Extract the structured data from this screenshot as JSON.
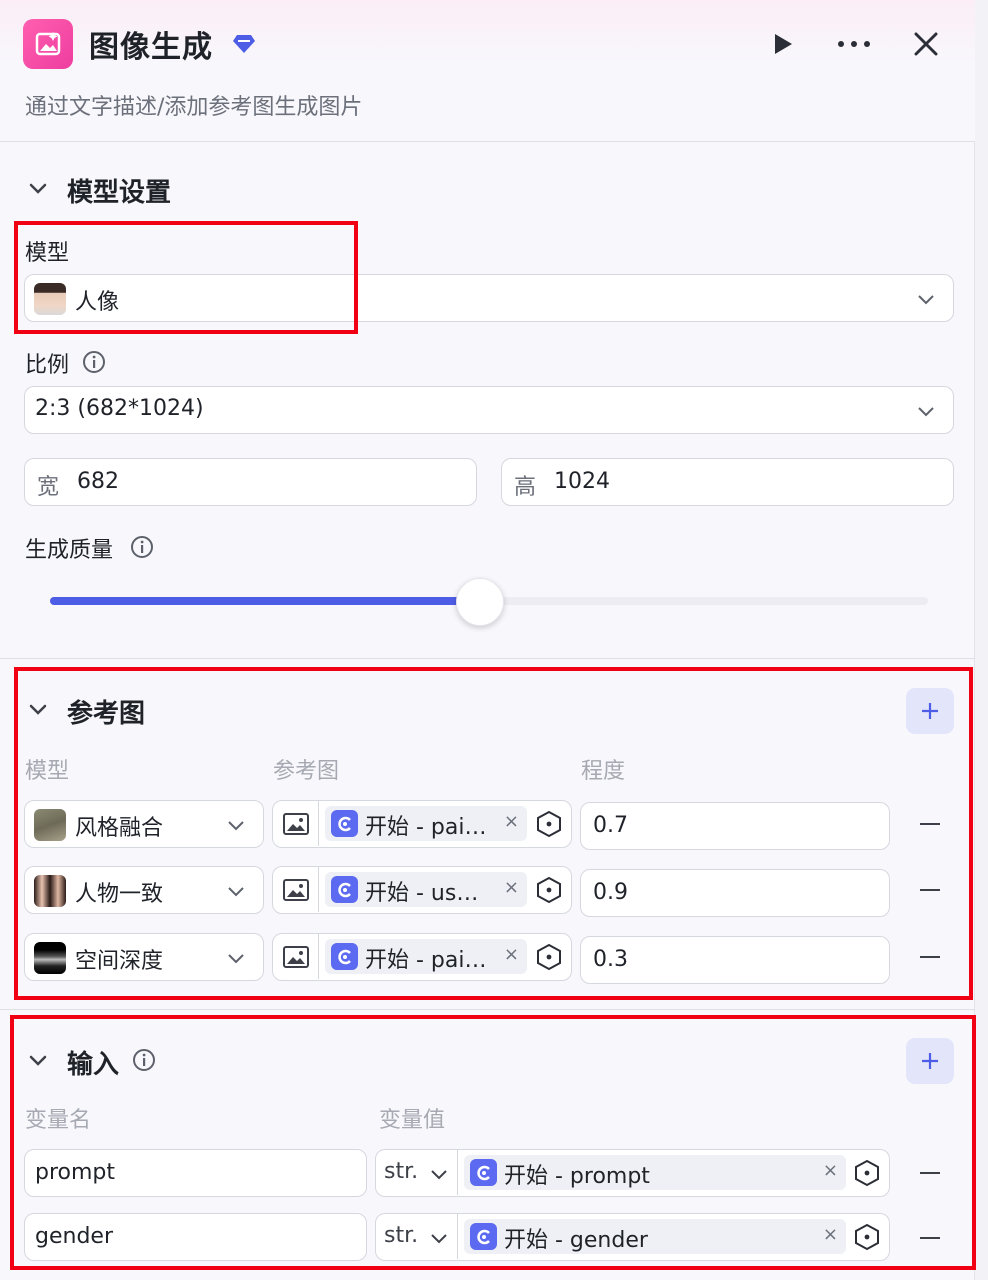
{
  "header": {
    "title": "图像生成",
    "subtitle": "通过文字描述/添加参考图生成图片"
  },
  "model_settings": {
    "section_title": "模型设置",
    "model_label": "模型",
    "model_value": "人像",
    "ratio_label": "比例",
    "ratio_value": "2:3 (682*1024)",
    "width_label": "宽",
    "width_value": "682",
    "height_label": "高",
    "height_value": "1024",
    "quality_label": "生成质量",
    "quality_level": 0.49
  },
  "reference": {
    "section_title": "参考图",
    "col_model": "模型",
    "col_ref": "参考图",
    "col_degree": "程度",
    "rows": [
      {
        "model": "风格融合",
        "ref_text": "开始 - pai…",
        "degree": "0.7"
      },
      {
        "model": "人物一致",
        "ref_text": "开始 - us…",
        "degree": "0.9"
      },
      {
        "model": "空间深度",
        "ref_text": "开始 - pai…",
        "degree": "0.3"
      }
    ]
  },
  "input": {
    "section_title": "输入",
    "col_name": "变量名",
    "col_value": "变量值",
    "rows": [
      {
        "name": "prompt",
        "type": "str.",
        "value": "开始 - prompt"
      },
      {
        "name": "gender",
        "type": "str.",
        "value": "开始 - gender"
      }
    ]
  },
  "colors": {
    "accent": "#4e5de6",
    "app_icon": "#ee3d9f",
    "highlight": "#f00012"
  }
}
